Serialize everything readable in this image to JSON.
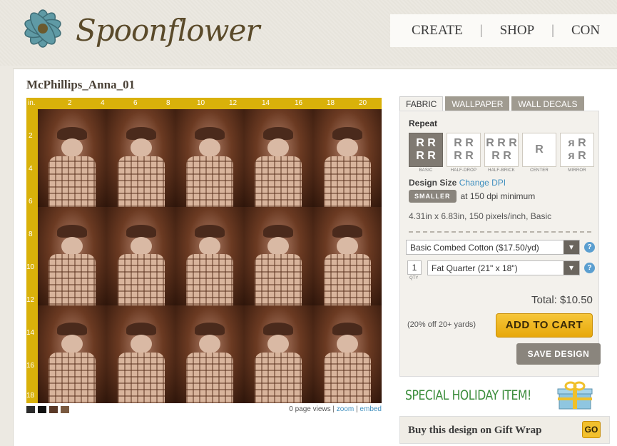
{
  "header": {
    "logo_text": "Spoonflower",
    "nav": [
      "CREATE",
      "SHOP",
      "CON"
    ],
    "separators": [
      "|",
      "|"
    ]
  },
  "design": {
    "title": "McPhillips_Anna_01",
    "ruler_unit": "in.",
    "ruler_top": [
      "2",
      "4",
      "6",
      "8",
      "10",
      "12",
      "14",
      "16",
      "18",
      "20"
    ],
    "ruler_left": [
      "2",
      "4",
      "6",
      "8",
      "10",
      "12",
      "14",
      "16",
      "18"
    ],
    "swatch_colors": [
      "#2b2b2b",
      "#111111",
      "#5a3a28",
      "#7a5a40"
    ],
    "views_text": "0 page views |",
    "zoom_link": "zoom",
    "divider": "|",
    "embed_link": "embed"
  },
  "sidebar": {
    "tabs": [
      "FABRIC",
      "WALLPAPER",
      "WALL DECALS"
    ],
    "active_tab": "FABRIC",
    "repeat_label": "Repeat",
    "repeat_options": [
      {
        "caption": "BASIC",
        "glyph": "R R\nR R",
        "active": true
      },
      {
        "caption": "HALF-DROP",
        "glyph": "R R\nR R",
        "active": false
      },
      {
        "caption": "HALF-BRICK",
        "glyph": "R R R\nR R",
        "active": false
      },
      {
        "caption": "CENTER",
        "glyph": "R",
        "active": false
      },
      {
        "caption": "MIRROR",
        "glyph": "R R\nR R",
        "active": false
      }
    ],
    "design_size_label": "Design Size",
    "change_dpi": "Change DPI",
    "smaller_button": "SMALLER",
    "dpi_text": "at 150 dpi minimum",
    "dims_text": "4.31in x 6.83in, 150 pixels/inch, Basic",
    "fabric_select": "Basic Combed Cotton ($17.50/yd)",
    "qty_value": "1",
    "qty_label": "QTY",
    "size_select": "Fat Quarter (21\" x 18\")",
    "total": "Total: $10.50",
    "discount": "(20% off 20+ yards)",
    "add_to_cart": "ADD TO CART",
    "save_design": "SAVE DESIGN",
    "help_glyph": "?",
    "arrow_glyph": "▾"
  },
  "promo": {
    "holiday_text": "SPECIAL HOLIDAY ITEM!",
    "giftwrap_text": "Buy this design on Gift Wrap",
    "go_button": "GO"
  }
}
